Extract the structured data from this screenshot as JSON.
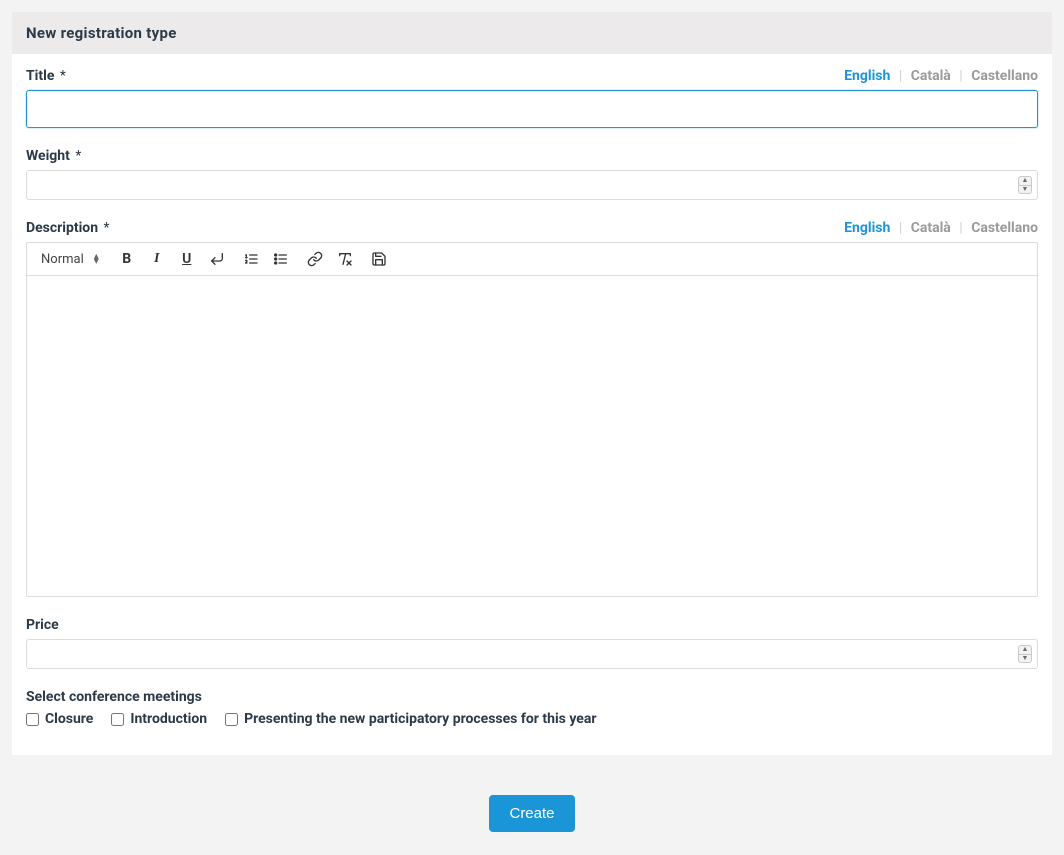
{
  "header": {
    "title": "New registration type"
  },
  "languages": {
    "options": [
      "English",
      "Català",
      "Castellano"
    ],
    "active_index": 0
  },
  "fields": {
    "title": {
      "label": "Title",
      "required": "*",
      "value": ""
    },
    "weight": {
      "label": "Weight",
      "required": "*",
      "value": ""
    },
    "description": {
      "label": "Description",
      "required": "*",
      "value": ""
    },
    "price": {
      "label": "Price",
      "value": ""
    },
    "meetings": {
      "label": "Select conference meetings",
      "options": [
        {
          "label": "Closure",
          "checked": false
        },
        {
          "label": "Introduction",
          "checked": false
        },
        {
          "label": "Presenting the new participatory processes for this year",
          "checked": false
        }
      ]
    }
  },
  "editor": {
    "format_label": "Normal",
    "icons": {
      "bold": "bold-icon",
      "italic": "italic-icon",
      "underline": "underline-icon",
      "return": "return-icon",
      "ordered_list": "ordered-list-icon",
      "unordered_list": "unordered-list-icon",
      "link": "link-icon",
      "clear_format": "clear-format-icon",
      "save": "save-icon"
    }
  },
  "actions": {
    "submit": "Create"
  }
}
